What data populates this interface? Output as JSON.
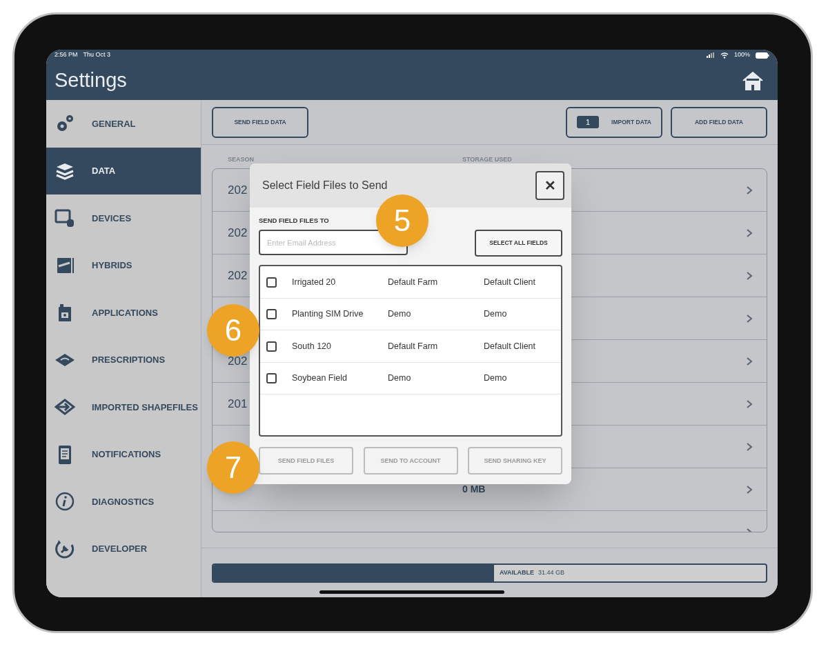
{
  "status_bar": {
    "time": "2:56 PM",
    "date": "Thu Oct 3",
    "battery": "100%"
  },
  "header": {
    "title": "Settings"
  },
  "sidebar": {
    "items": [
      {
        "label": "GENERAL",
        "kind": "gears",
        "selected": false
      },
      {
        "label": "DATA",
        "kind": "layers",
        "selected": true
      },
      {
        "label": "DEVICES",
        "kind": "devices",
        "selected": false
      },
      {
        "label": "HYBRIDS",
        "kind": "bag",
        "selected": false
      },
      {
        "label": "APPLICATIONS",
        "kind": "jug",
        "selected": false
      },
      {
        "label": "PRESCRIPTIONS",
        "kind": "map",
        "selected": false
      },
      {
        "label": "IMPORTED SHAPEFILES",
        "kind": "import",
        "selected": false
      },
      {
        "label": "NOTIFICATIONS",
        "kind": "tablet",
        "selected": false
      },
      {
        "label": "DIAGNOSTICS",
        "kind": "info",
        "selected": false
      },
      {
        "label": "DEVELOPER",
        "kind": "wrench",
        "selected": false
      }
    ]
  },
  "toolbar": {
    "send_button": "SEND FIELD DATA",
    "import_count": "1",
    "import_button": "IMPORT DATA",
    "add_button": "ADD FIELD DATA"
  },
  "seasons": {
    "columns": [
      "SEASON",
      "STORAGE USED"
    ],
    "rows": [
      {
        "season": "202",
        "storage": ""
      },
      {
        "season": "202",
        "storage": ""
      },
      {
        "season": "202",
        "storage": ""
      },
      {
        "season": "",
        "storage": ""
      },
      {
        "season": "202",
        "storage": ""
      },
      {
        "season": "201",
        "storage": ""
      },
      {
        "season": "",
        "storage": ""
      },
      {
        "season": "",
        "storage": "0 MB"
      },
      {
        "season": "",
        "storage": ""
      }
    ]
  },
  "storage": {
    "level": 0.508,
    "label": "AVAILABLE",
    "value": "31.44 GB"
  },
  "dialog": {
    "title": "Select Field Files to Send",
    "close": "✕",
    "to_label": "SEND FIELD FILES TO",
    "email": {
      "placeholder": "Enter Email Address"
    },
    "select_all": "SELECT ALL FIELDS",
    "files": [
      {
        "name": "Irrigated 20",
        "farm": "Default Farm",
        "client": "Default Client",
        "checked": false
      },
      {
        "name": "Planting SIM Drive",
        "farm": "Demo",
        "client": "Demo",
        "checked": false
      },
      {
        "name": "South 120",
        "farm": "Default Farm",
        "client": "Default Client",
        "checked": false
      },
      {
        "name": "Soybean Field",
        "farm": "Demo",
        "client": "Demo",
        "checked": false
      }
    ],
    "buttons": [
      {
        "label": "SEND FIELD FILES",
        "disabled": true
      },
      {
        "label": "SEND TO ACCOUNT",
        "disabled": true
      },
      {
        "label": "SEND SHARING KEY",
        "disabled": true
      }
    ]
  },
  "callouts": [
    {
      "number": "5",
      "kind": "email"
    },
    {
      "number": "6",
      "kind": "list"
    },
    {
      "number": "7",
      "kind": "buttons"
    }
  ]
}
